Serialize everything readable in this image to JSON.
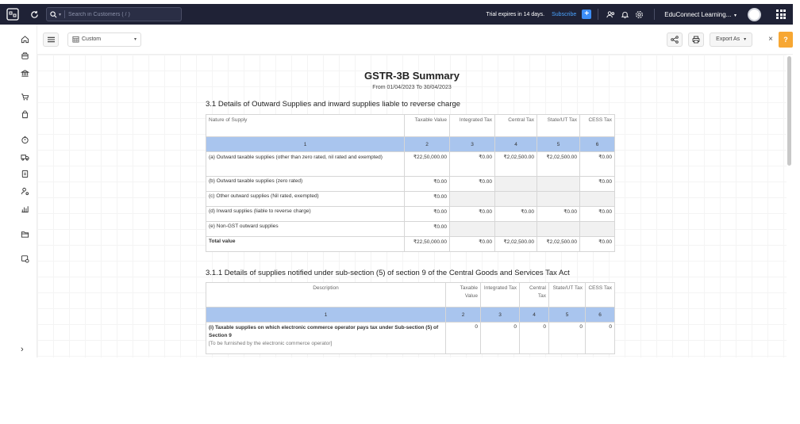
{
  "topbar": {
    "search_placeholder": "Search in Customers ( / )",
    "trial_text": "Trial expires in 14 days.",
    "subscribe_label": "Subscribe",
    "org_name": "EduConnect Learning...",
    "accent_color": "#3d8ef7"
  },
  "toolbar": {
    "filter_label": "Custom",
    "export_label": "Export As",
    "help_label": "?",
    "close_label": "×"
  },
  "report": {
    "title": "GSTR-3B Summary",
    "period": "From 01/04/2023  To 30/04/2023",
    "section1": {
      "title": "3.1 Details of Outward Supplies and inward supplies liable to reverse charge",
      "headers": [
        "Nature of Supply",
        "Taxable Value",
        "Integrated Tax",
        "Central Tax",
        "State/UT Tax",
        "CESS Tax"
      ],
      "col_numbers": [
        "1",
        "2",
        "3",
        "4",
        "5",
        "6"
      ],
      "rows": [
        {
          "label": "(a) Outward taxable supplies (other than zero rated, nil rated and exempted)",
          "values": [
            "₹22,50,000.00",
            "₹0.00",
            "₹2,02,500.00",
            "₹2,02,500.00",
            "₹0.00"
          ]
        },
        {
          "label": "(b) Outward taxable supplies (zero rated)",
          "values": [
            "₹0.00",
            "₹0.00",
            "",
            "",
            "₹0.00"
          ]
        },
        {
          "label": "(c) Other outward supplies (Nil rated, exempted)",
          "values": [
            "₹0.00",
            "",
            "",
            "",
            ""
          ]
        },
        {
          "label": "(d) Inward supplies (liable to reverse charge)",
          "values": [
            "₹0.00",
            "₹0.00",
            "₹0.00",
            "₹0.00",
            "₹0.00"
          ]
        },
        {
          "label": "(e) Non-GST outward supplies",
          "values": [
            "₹0.00",
            "",
            "",
            "",
            ""
          ]
        },
        {
          "label": "Total value",
          "values": [
            "₹22,50,000.00",
            "₹0.00",
            "₹2,02,500.00",
            "₹2,02,500.00",
            "₹0.00"
          ]
        }
      ]
    },
    "section2": {
      "title": "3.1.1 Details of supplies notified under sub-section (5) of section 9 of the Central Goods and Services Tax Act",
      "headers": [
        "Description",
        "Taxable Value",
        "Integrated Tax",
        "Central Tax",
        "State/UT Tax",
        "CESS Tax"
      ],
      "col_numbers": [
        "1",
        "2",
        "3",
        "4",
        "5",
        "6"
      ],
      "rows": [
        {
          "label": "(i) Taxable supplies on which electronic commerce operator pays tax under Sub-section (5) of Section 9",
          "note": "[To be furnished by the electronic commerce operator]",
          "values": [
            "0",
            "0",
            "0",
            "0",
            "0"
          ]
        }
      ]
    }
  }
}
